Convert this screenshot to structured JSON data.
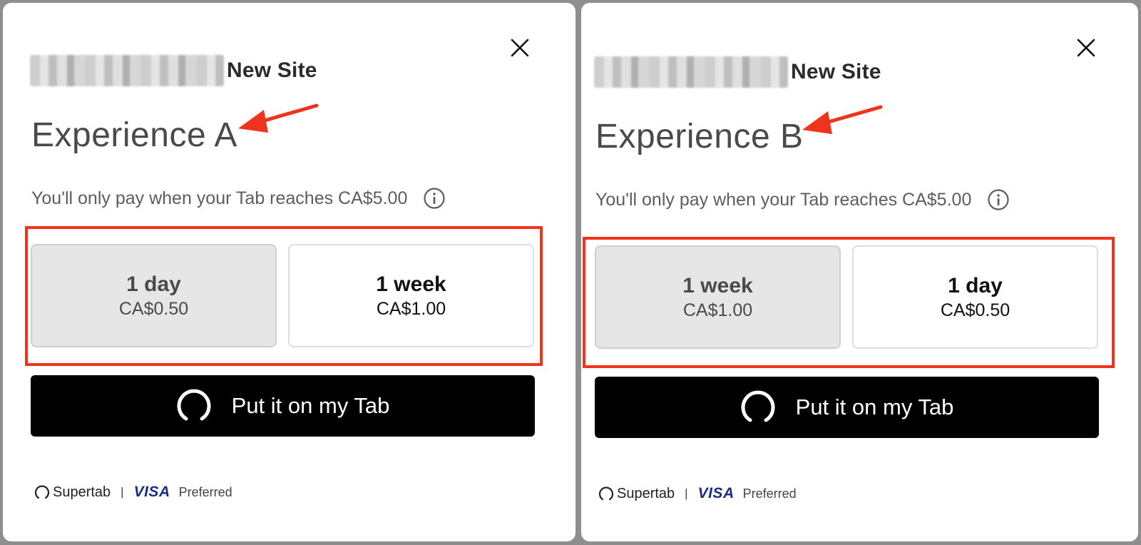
{
  "accent_colors": {
    "highlight": "#f0331c",
    "button_bg": "#000000",
    "selected_card_bg": "#e6e6e6",
    "visa_blue": "#1a2d7f"
  },
  "panels": [
    {
      "site_name": "New Site",
      "experience_title": "Experience A",
      "pay_notice": "You'll only pay when your Tab reaches CA$5.00",
      "options": [
        {
          "period": "1 day",
          "price": "CA$0.50",
          "selected": true
        },
        {
          "period": "1 week",
          "price": "CA$1.00",
          "selected": false
        }
      ],
      "cta_label": "Put it on my Tab",
      "footer": {
        "brand": "Supertab",
        "separator": "|",
        "card": "VISA",
        "card_note": "Preferred"
      },
      "icons": [
        "close-icon",
        "info-icon",
        "supertab-ring-icon"
      ]
    },
    {
      "site_name": "New Site",
      "experience_title": "Experience B",
      "pay_notice": "You'll only pay when your Tab reaches CA$5.00",
      "options": [
        {
          "period": "1 week",
          "price": "CA$1.00",
          "selected": true
        },
        {
          "period": "1 day",
          "price": "CA$0.50",
          "selected": false
        }
      ],
      "cta_label": "Put it on my Tab",
      "footer": {
        "brand": "Supertab",
        "separator": "|",
        "card": "VISA",
        "card_note": "Preferred"
      },
      "icons": [
        "close-icon",
        "info-icon",
        "supertab-ring-icon"
      ]
    }
  ]
}
